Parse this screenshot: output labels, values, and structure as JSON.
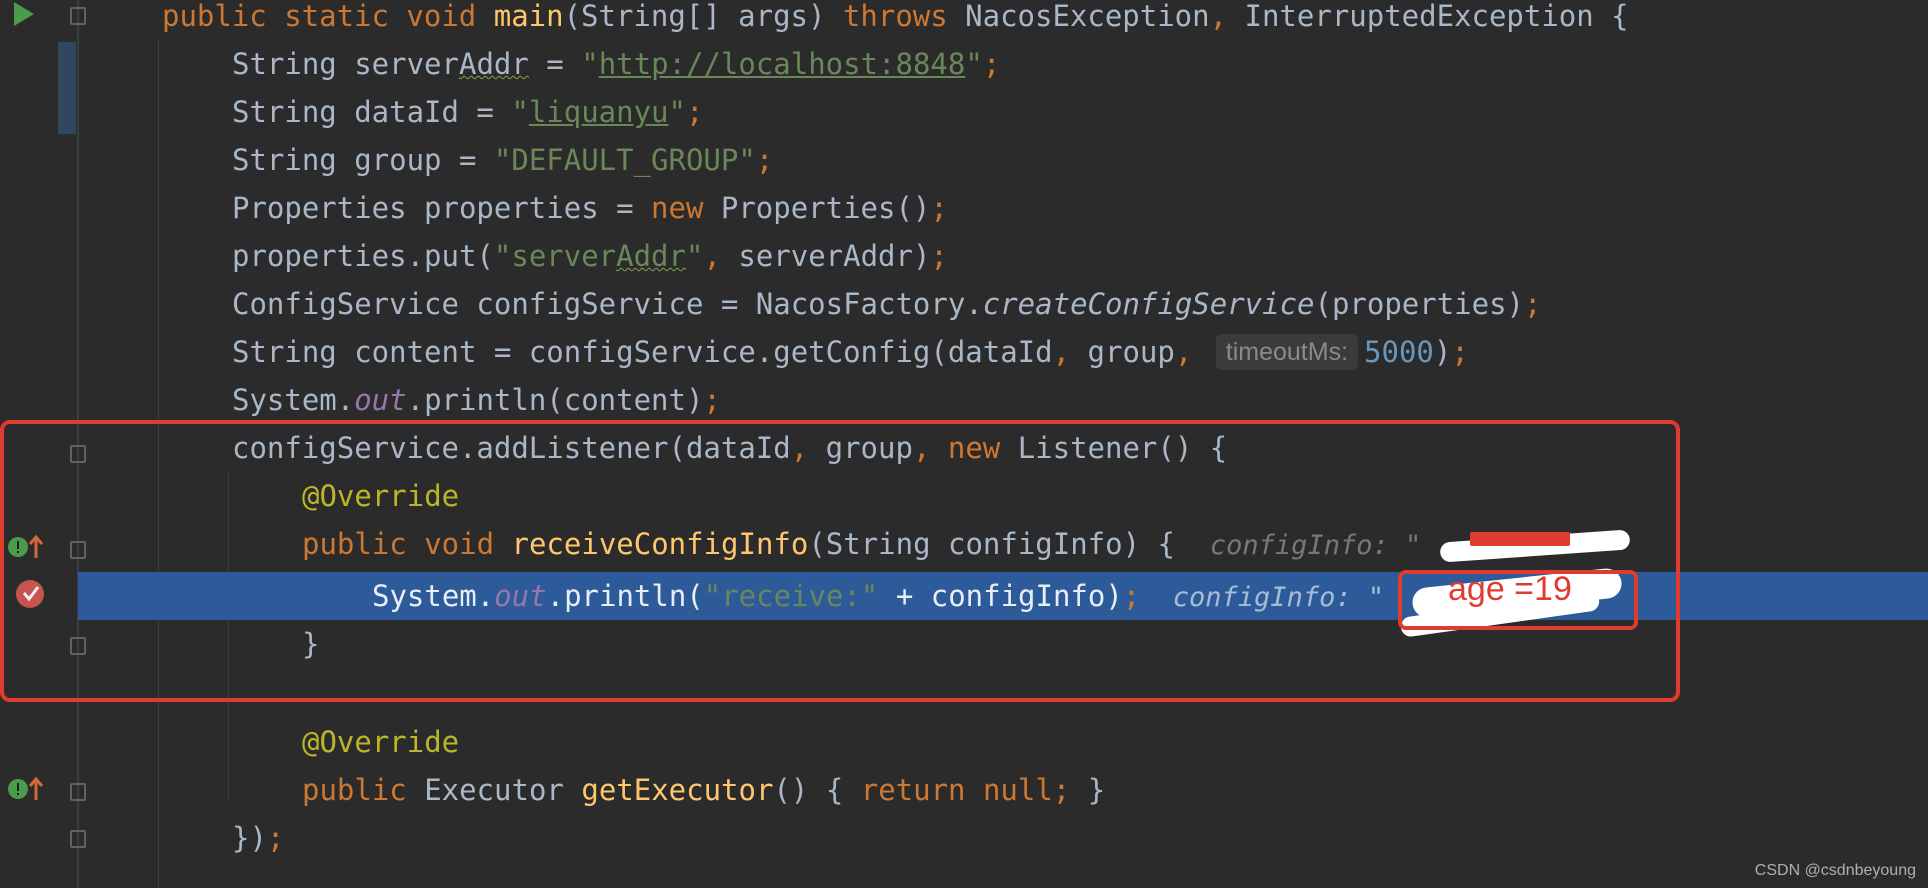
{
  "editor": {
    "lines": [
      {
        "id": "l1",
        "parts": [
          [
            "kw",
            "public static void "
          ],
          [
            "fn",
            "main"
          ],
          [
            "",
            "(String[] args) "
          ],
          [
            "kw",
            "throws "
          ],
          [
            "",
            "NacosException"
          ],
          [
            "punct",
            ", "
          ],
          [
            "",
            "InterruptedException {"
          ]
        ]
      },
      {
        "id": "l2",
        "parts": [
          [
            "",
            "String server"
          ],
          [
            "squiggle",
            "Addr"
          ],
          [
            "",
            " = "
          ],
          [
            "str",
            "\""
          ],
          [
            "str-link",
            "http://localhost:8848"
          ],
          [
            "str",
            "\""
          ],
          [
            "punct",
            ";"
          ]
        ]
      },
      {
        "id": "l3",
        "parts": [
          [
            "",
            "String dataId = "
          ],
          [
            "str",
            "\""
          ],
          [
            "str-link",
            "liquanyu"
          ],
          [
            "str",
            "\""
          ],
          [
            "punct",
            ";"
          ]
        ]
      },
      {
        "id": "l4",
        "parts": [
          [
            "",
            "String group = "
          ],
          [
            "str",
            "\"DEFAULT_GROUP\""
          ],
          [
            "punct",
            ";"
          ]
        ]
      },
      {
        "id": "l5",
        "parts": [
          [
            "",
            "Properties properties = "
          ],
          [
            "kw",
            "new "
          ],
          [
            "",
            "Properties()"
          ],
          [
            "punct",
            ";"
          ]
        ]
      },
      {
        "id": "l6",
        "parts": [
          [
            "",
            "properties.put("
          ],
          [
            "str",
            "\"server"
          ],
          [
            "str-squiggle",
            "Addr"
          ],
          [
            "str",
            "\""
          ],
          [
            "punct",
            ", "
          ],
          [
            "",
            "serverAddr)"
          ],
          [
            "punct",
            ";"
          ]
        ]
      },
      {
        "id": "l7",
        "parts": [
          [
            "",
            "ConfigService configService = NacosFactory."
          ],
          [
            "ital",
            "createConfigService"
          ],
          [
            "",
            "(properties)"
          ],
          [
            "punct",
            ";"
          ]
        ]
      },
      {
        "id": "l8",
        "parts": [
          [
            "",
            "String content = configService.getConfig(dataId"
          ],
          [
            "punct",
            ", "
          ],
          [
            "",
            "group"
          ],
          [
            "punct",
            ", "
          ],
          [
            "inlay",
            "timeoutMs:"
          ],
          [
            "num",
            "5000"
          ],
          [
            "",
            ")"
          ],
          [
            "punct",
            ";"
          ]
        ]
      },
      {
        "id": "l9",
        "parts": [
          [
            "",
            "System."
          ],
          [
            "field",
            "out"
          ],
          [
            "",
            ".println(content)"
          ],
          [
            "punct",
            ";"
          ]
        ]
      },
      {
        "id": "l10",
        "parts": [
          [
            "",
            "configService.addListener(dataId"
          ],
          [
            "punct",
            ", "
          ],
          [
            "",
            "group"
          ],
          [
            "punct",
            ", "
          ],
          [
            "kw",
            "new "
          ],
          [
            "",
            "Listener() {"
          ]
        ]
      },
      {
        "id": "l11",
        "parts": [
          [
            "ann",
            "@Override"
          ]
        ]
      },
      {
        "id": "l12",
        "parts": [
          [
            "kw",
            "public void "
          ],
          [
            "fn",
            "receiveConfigInfo"
          ],
          [
            "",
            "(String configInfo) {  "
          ],
          [
            "hint",
            "configInfo: \""
          ]
        ]
      },
      {
        "id": "l13",
        "parts": [
          [
            "",
            "System."
          ],
          [
            "field",
            "out"
          ],
          [
            "",
            ".println("
          ],
          [
            "str",
            "\"receive:\""
          ],
          [
            "",
            " + configInfo)"
          ],
          [
            "punct",
            ";"
          ],
          [
            "hint",
            "  configInfo: \""
          ]
        ]
      },
      {
        "id": "l14",
        "parts": [
          [
            "",
            "}"
          ]
        ]
      },
      {
        "id": "l15",
        "parts": []
      },
      {
        "id": "l16",
        "parts": [
          [
            "ann",
            "@Override"
          ]
        ]
      },
      {
        "id": "l17",
        "parts": [
          [
            "kw",
            "public "
          ],
          [
            "",
            "Executor "
          ],
          [
            "fn",
            "getExecutor"
          ],
          [
            "",
            "() "
          ],
          [
            "",
            "{ "
          ],
          [
            "kw",
            "return null"
          ],
          [
            "punct",
            ";"
          ],
          [
            "",
            " }"
          ]
        ]
      },
      {
        "id": "l18",
        "parts": [
          [
            "",
            "})"
          ],
          [
            "punct",
            ";"
          ]
        ]
      }
    ]
  },
  "annotation": {
    "age_label": "age =19"
  },
  "watermark": "CSDN @csdnbeyoung",
  "icons": {
    "run": "run-icon",
    "override": "override-icon",
    "breakpoint": "breakpoint-icon"
  },
  "colors": {
    "background": "#2b2b2b",
    "highlight": "#2d5b9a",
    "annotation_red": "#e03b2f"
  }
}
